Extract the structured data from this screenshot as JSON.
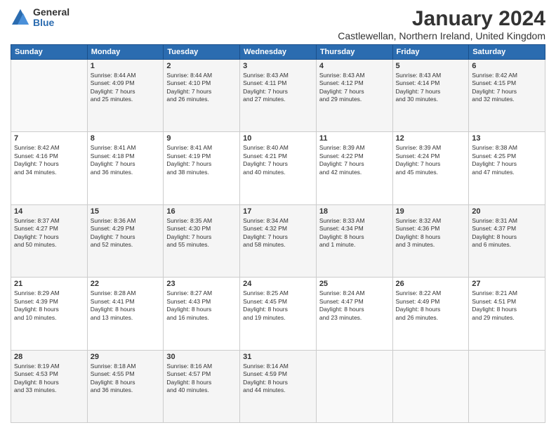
{
  "logo": {
    "general": "General",
    "blue": "Blue"
  },
  "title": "January 2024",
  "location": "Castlewellan, Northern Ireland, United Kingdom",
  "days_header": [
    "Sunday",
    "Monday",
    "Tuesday",
    "Wednesday",
    "Thursday",
    "Friday",
    "Saturday"
  ],
  "weeks": [
    [
      {
        "num": "",
        "info": ""
      },
      {
        "num": "1",
        "info": "Sunrise: 8:44 AM\nSunset: 4:09 PM\nDaylight: 7 hours\nand 25 minutes."
      },
      {
        "num": "2",
        "info": "Sunrise: 8:44 AM\nSunset: 4:10 PM\nDaylight: 7 hours\nand 26 minutes."
      },
      {
        "num": "3",
        "info": "Sunrise: 8:43 AM\nSunset: 4:11 PM\nDaylight: 7 hours\nand 27 minutes."
      },
      {
        "num": "4",
        "info": "Sunrise: 8:43 AM\nSunset: 4:12 PM\nDaylight: 7 hours\nand 29 minutes."
      },
      {
        "num": "5",
        "info": "Sunrise: 8:43 AM\nSunset: 4:14 PM\nDaylight: 7 hours\nand 30 minutes."
      },
      {
        "num": "6",
        "info": "Sunrise: 8:42 AM\nSunset: 4:15 PM\nDaylight: 7 hours\nand 32 minutes."
      }
    ],
    [
      {
        "num": "7",
        "info": "Sunrise: 8:42 AM\nSunset: 4:16 PM\nDaylight: 7 hours\nand 34 minutes."
      },
      {
        "num": "8",
        "info": "Sunrise: 8:41 AM\nSunset: 4:18 PM\nDaylight: 7 hours\nand 36 minutes."
      },
      {
        "num": "9",
        "info": "Sunrise: 8:41 AM\nSunset: 4:19 PM\nDaylight: 7 hours\nand 38 minutes."
      },
      {
        "num": "10",
        "info": "Sunrise: 8:40 AM\nSunset: 4:21 PM\nDaylight: 7 hours\nand 40 minutes."
      },
      {
        "num": "11",
        "info": "Sunrise: 8:39 AM\nSunset: 4:22 PM\nDaylight: 7 hours\nand 42 minutes."
      },
      {
        "num": "12",
        "info": "Sunrise: 8:39 AM\nSunset: 4:24 PM\nDaylight: 7 hours\nand 45 minutes."
      },
      {
        "num": "13",
        "info": "Sunrise: 8:38 AM\nSunset: 4:25 PM\nDaylight: 7 hours\nand 47 minutes."
      }
    ],
    [
      {
        "num": "14",
        "info": "Sunrise: 8:37 AM\nSunset: 4:27 PM\nDaylight: 7 hours\nand 50 minutes."
      },
      {
        "num": "15",
        "info": "Sunrise: 8:36 AM\nSunset: 4:29 PM\nDaylight: 7 hours\nand 52 minutes."
      },
      {
        "num": "16",
        "info": "Sunrise: 8:35 AM\nSunset: 4:30 PM\nDaylight: 7 hours\nand 55 minutes."
      },
      {
        "num": "17",
        "info": "Sunrise: 8:34 AM\nSunset: 4:32 PM\nDaylight: 7 hours\nand 58 minutes."
      },
      {
        "num": "18",
        "info": "Sunrise: 8:33 AM\nSunset: 4:34 PM\nDaylight: 8 hours\nand 1 minute."
      },
      {
        "num": "19",
        "info": "Sunrise: 8:32 AM\nSunset: 4:36 PM\nDaylight: 8 hours\nand 3 minutes."
      },
      {
        "num": "20",
        "info": "Sunrise: 8:31 AM\nSunset: 4:37 PM\nDaylight: 8 hours\nand 6 minutes."
      }
    ],
    [
      {
        "num": "21",
        "info": "Sunrise: 8:29 AM\nSunset: 4:39 PM\nDaylight: 8 hours\nand 10 minutes."
      },
      {
        "num": "22",
        "info": "Sunrise: 8:28 AM\nSunset: 4:41 PM\nDaylight: 8 hours\nand 13 minutes."
      },
      {
        "num": "23",
        "info": "Sunrise: 8:27 AM\nSunset: 4:43 PM\nDaylight: 8 hours\nand 16 minutes."
      },
      {
        "num": "24",
        "info": "Sunrise: 8:25 AM\nSunset: 4:45 PM\nDaylight: 8 hours\nand 19 minutes."
      },
      {
        "num": "25",
        "info": "Sunrise: 8:24 AM\nSunset: 4:47 PM\nDaylight: 8 hours\nand 23 minutes."
      },
      {
        "num": "26",
        "info": "Sunrise: 8:22 AM\nSunset: 4:49 PM\nDaylight: 8 hours\nand 26 minutes."
      },
      {
        "num": "27",
        "info": "Sunrise: 8:21 AM\nSunset: 4:51 PM\nDaylight: 8 hours\nand 29 minutes."
      }
    ],
    [
      {
        "num": "28",
        "info": "Sunrise: 8:19 AM\nSunset: 4:53 PM\nDaylight: 8 hours\nand 33 minutes."
      },
      {
        "num": "29",
        "info": "Sunrise: 8:18 AM\nSunset: 4:55 PM\nDaylight: 8 hours\nand 36 minutes."
      },
      {
        "num": "30",
        "info": "Sunrise: 8:16 AM\nSunset: 4:57 PM\nDaylight: 8 hours\nand 40 minutes."
      },
      {
        "num": "31",
        "info": "Sunrise: 8:14 AM\nSunset: 4:59 PM\nDaylight: 8 hours\nand 44 minutes."
      },
      {
        "num": "",
        "info": ""
      },
      {
        "num": "",
        "info": ""
      },
      {
        "num": "",
        "info": ""
      }
    ]
  ]
}
